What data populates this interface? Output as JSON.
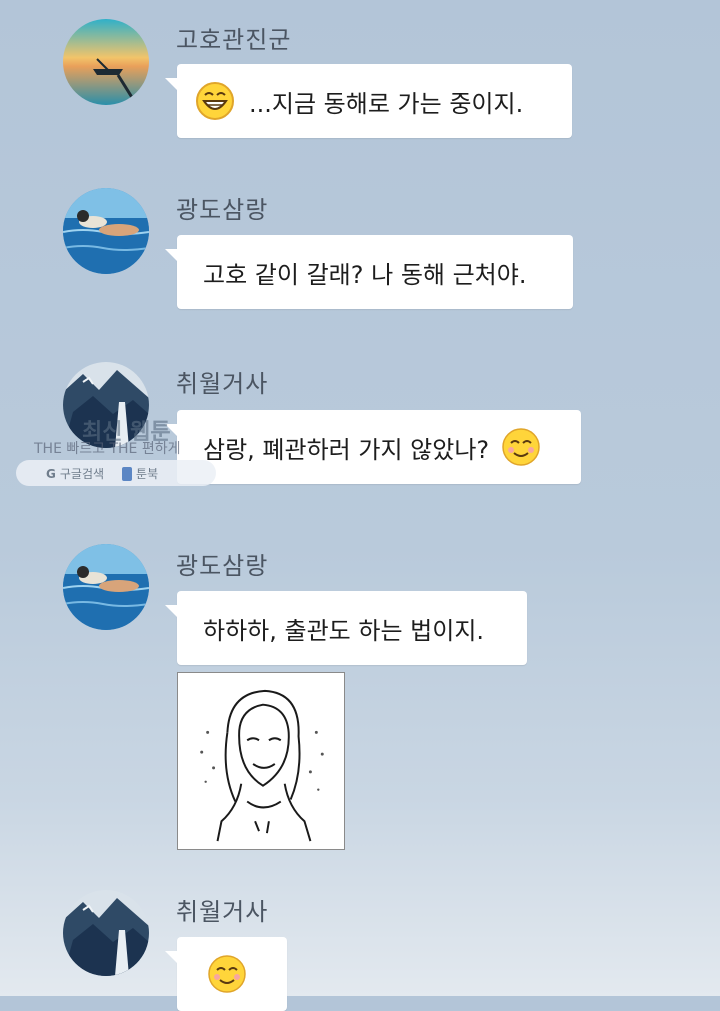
{
  "messages": [
    {
      "sender": "고호관진군",
      "text": "...지금 동해로 가는 중이지.",
      "avatar": "boat-sunset-avatar",
      "emoji": "grinning-face-icon"
    },
    {
      "sender": "광도삼랑",
      "text": "고호 같이 갈래? 나 동해 근처야.",
      "avatar": "sea-swimmer-avatar"
    },
    {
      "sender": "취월거사",
      "text": "삼랑, 폐관하러 가지 않았나?",
      "avatar": "mountain-waterfall-avatar",
      "emoji": "smiling-face-icon"
    },
    {
      "sender": "광도삼랑",
      "text": "하하하, 출관도 하는 법이지.",
      "avatar": "sea-swimmer-avatar",
      "sticker": "smug-longhair-man-sticker"
    },
    {
      "sender": "취월거사",
      "text": "",
      "avatar": "mountain-waterfall-avatar",
      "emoji": "smiling-face-icon"
    }
  ],
  "watermark": {
    "title": "최신 웹툰",
    "subtitle": "THE 빠르고 THE 편하게",
    "google_label": "구글검색",
    "google_letter": "G",
    "book_label": "툰북"
  },
  "colors": {
    "background_top": "#b3c5d8",
    "background_bottom": "#e3e9ef",
    "bubble": "#ffffff",
    "sender_name": "#4b5562",
    "emoji_yellow": "#ffd53a"
  }
}
